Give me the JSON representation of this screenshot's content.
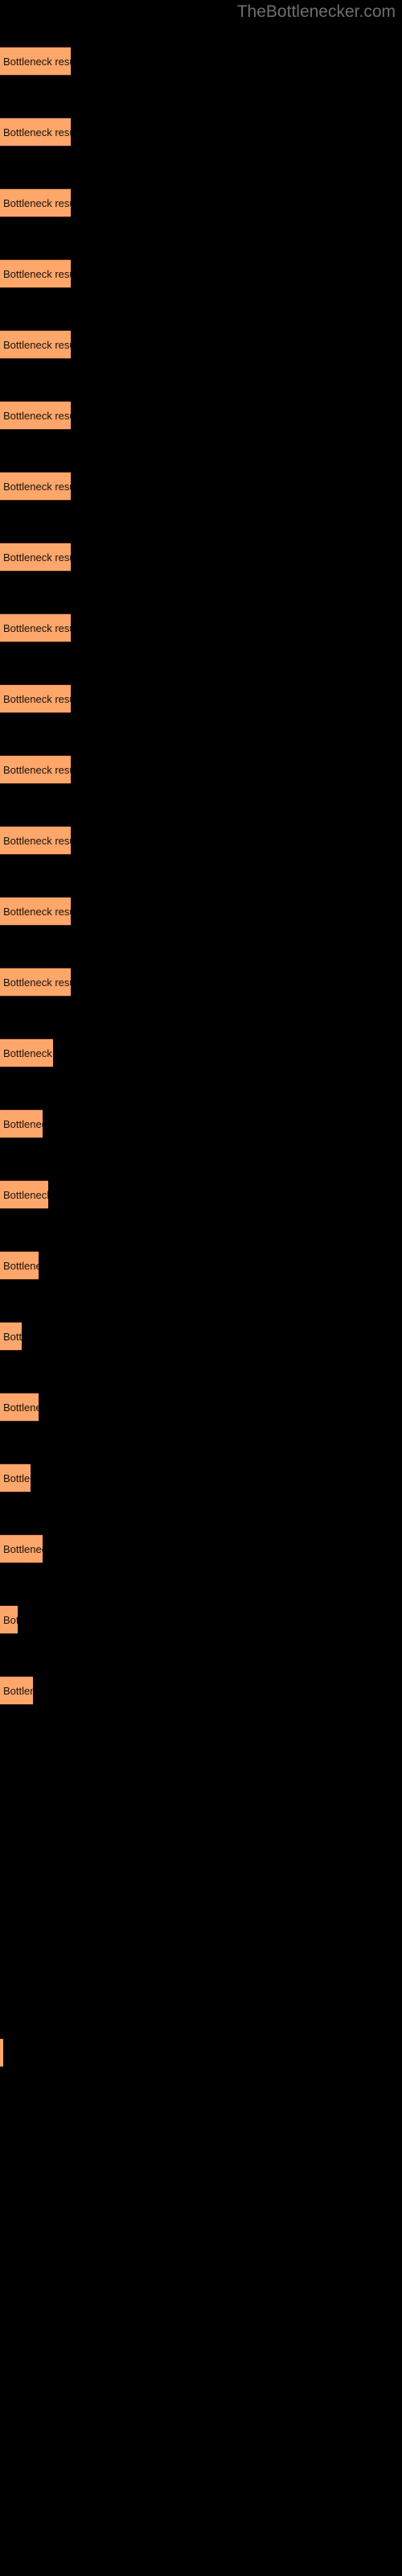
{
  "site": {
    "title": "TheBottlenecker.com"
  },
  "colors": {
    "background": "#000000",
    "bar_fill": "#ffa66b",
    "bar_border": "#3a1e0d",
    "title_text": "#6e6e6e",
    "bar_label_text": "#1a1208"
  },
  "bar_label": "Bottleneck result",
  "chart_data": {
    "type": "bar",
    "orientation": "horizontal",
    "title": "TheBottlenecker.com",
    "xlabel": "",
    "ylabel": "",
    "grid": false,
    "legend": false,
    "categories": [
      "Bottleneck result",
      "Bottleneck result",
      "Bottleneck result",
      "Bottleneck result",
      "Bottleneck result",
      "Bottleneck result",
      "Bottleneck result",
      "Bottleneck result",
      "Bottleneck result",
      "Bottleneck result",
      "Bottleneck result",
      "Bottleneck result",
      "Bottleneck result",
      "Bottleneck result",
      "Bottleneck result",
      "Bottleneck result",
      "Bottleneck result",
      "Bottleneck result",
      "Bottleneck result",
      "Bottleneck result",
      "Bottleneck result",
      "Bottleneck result",
      "Bottleneck result",
      "Bottleneck result"
    ],
    "values": [
      88,
      88,
      88,
      88,
      88,
      88,
      88,
      88,
      88,
      88,
      88,
      88,
      88,
      88,
      66,
      53,
      60,
      48,
      27,
      48,
      38,
      53,
      22,
      41
    ],
    "xlim": [
      0,
      500
    ],
    "bars": [
      {
        "index": 1,
        "top": 58,
        "width": 88,
        "label": "Bottleneck result"
      },
      {
        "index": 2,
        "top": 146,
        "width": 88,
        "label": "Bottleneck result"
      },
      {
        "index": 3,
        "top": 234,
        "width": 88,
        "label": "Bottleneck result"
      },
      {
        "index": 4,
        "top": 322,
        "width": 88,
        "label": "Bottleneck result"
      },
      {
        "index": 5,
        "top": 410,
        "width": 88,
        "label": "Bottleneck result"
      },
      {
        "index": 6,
        "top": 498,
        "width": 88,
        "label": "Bottleneck result"
      },
      {
        "index": 7,
        "top": 586,
        "width": 88,
        "label": "Bottleneck result"
      },
      {
        "index": 8,
        "top": 674,
        "width": 88,
        "label": "Bottleneck result"
      },
      {
        "index": 9,
        "top": 762,
        "width": 88,
        "label": "Bottleneck result"
      },
      {
        "index": 10,
        "top": 850,
        "width": 88,
        "label": "Bottleneck result"
      },
      {
        "index": 11,
        "top": 938,
        "width": 88,
        "label": "Bottleneck result"
      },
      {
        "index": 12,
        "top": 1026,
        "width": 88,
        "label": "Bottleneck result"
      },
      {
        "index": 13,
        "top": 1114,
        "width": 88,
        "label": "Bottleneck result"
      },
      {
        "index": 14,
        "top": 1202,
        "width": 88,
        "label": "Bottleneck result"
      },
      {
        "index": 15,
        "top": 1290,
        "width": 66,
        "label": "Bottleneck result"
      },
      {
        "index": 16,
        "top": 1378,
        "width": 53,
        "label": "Bottleneck result"
      },
      {
        "index": 17,
        "top": 1466,
        "width": 60,
        "label": "Bottleneck result"
      },
      {
        "index": 18,
        "top": 1554,
        "width": 48,
        "label": "Bottleneck result"
      },
      {
        "index": 19,
        "top": 1642,
        "width": 27,
        "label": "Bottleneck result"
      },
      {
        "index": 20,
        "top": 1730,
        "width": 48,
        "label": "Bottleneck result"
      },
      {
        "index": 21,
        "top": 1818,
        "width": 38,
        "label": "Bottleneck result"
      },
      {
        "index": 22,
        "top": 1906,
        "width": 53,
        "label": "Bottleneck result"
      },
      {
        "index": 23,
        "top": 1994,
        "width": 22,
        "label": "Bottleneck result"
      },
      {
        "index": 24,
        "top": 2082,
        "width": 41,
        "label": "Bottleneck result"
      },
      {
        "index": 25,
        "top": 2532,
        "width": 4,
        "label": ""
      }
    ]
  }
}
